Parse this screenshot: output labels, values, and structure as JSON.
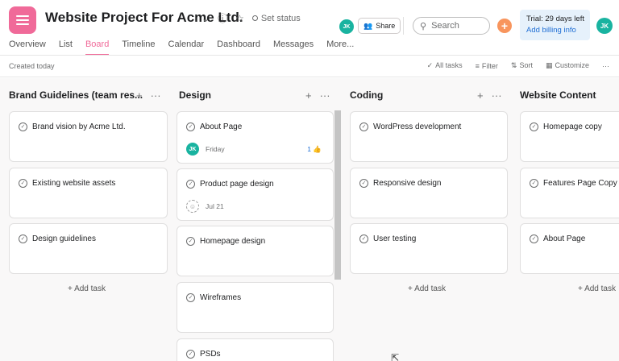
{
  "header": {
    "project_title": "Website Project For Acme Ltd.",
    "set_status": "Set status",
    "share_label": "Share",
    "search_placeholder": "Search",
    "trial_text": "Trial: 29 days left",
    "billing_link": "Add billing info",
    "avatar_initials": "JK",
    "accent_color": "#f06a99"
  },
  "tabs": [
    {
      "label": "Overview"
    },
    {
      "label": "List"
    },
    {
      "label": "Board",
      "active": true
    },
    {
      "label": "Timeline"
    },
    {
      "label": "Calendar"
    },
    {
      "label": "Dashboard"
    },
    {
      "label": "Messages"
    },
    {
      "label": "More..."
    }
  ],
  "toolbar": {
    "created": "Created today",
    "all_tasks": "All tasks",
    "filter": "Filter",
    "sort": "Sort",
    "customize": "Customize"
  },
  "columns": [
    {
      "title": "Brand Guidelines (team res...",
      "tasks": [
        {
          "name": "Brand vision by Acme Ltd."
        },
        {
          "name": "Existing website assets"
        },
        {
          "name": "Design guidelines"
        }
      ],
      "add_task": "+ Add task"
    },
    {
      "title": "Design",
      "tasks": [
        {
          "name": "About Page",
          "assignee": "JK",
          "due": "Friday",
          "likes": "1"
        },
        {
          "name": "Product page design",
          "due": "Jul 21"
        },
        {
          "name": "Homepage design"
        },
        {
          "name": "Wireframes"
        },
        {
          "name": "PSDs"
        }
      ]
    },
    {
      "title": "Coding",
      "tasks": [
        {
          "name": "WordPress development"
        },
        {
          "name": "Responsive design"
        },
        {
          "name": "User testing"
        }
      ],
      "add_task": "+ Add task"
    },
    {
      "title": "Website Content",
      "tasks": [
        {
          "name": "Homepage copy"
        },
        {
          "name": "Features Page Copy"
        },
        {
          "name": "About Page"
        }
      ],
      "add_task": "+ Add task"
    }
  ]
}
